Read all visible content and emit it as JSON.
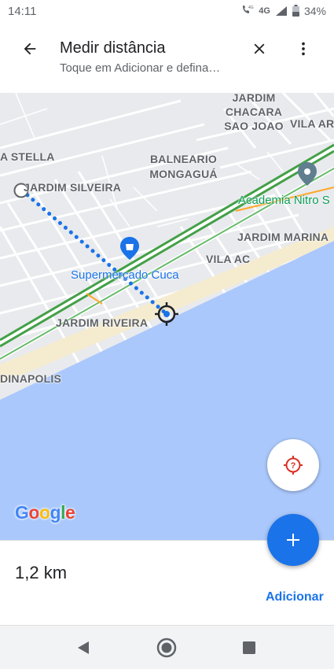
{
  "status_bar": {
    "time": "14:11",
    "network": "4G",
    "battery": "34%"
  },
  "header": {
    "title": "Medir distância",
    "subtitle": "Toque em Adicionar e defina…",
    "icons": {
      "back": "arrow-back-icon",
      "close": "close-icon",
      "more": "more-vert-icon"
    }
  },
  "map": {
    "labels": {
      "jardim_chacara": "JARDIM CHACARA SAO JOAO",
      "vila_ar": "VILA AR",
      "stella": "A STELLA",
      "balneario": "BALNEARIO MONGAGUÁ",
      "jardim_silveira": "JARDIM SILVEIRA",
      "jardim_marina": "JARDIM MARINA",
      "vila_ac": "VILA AC",
      "jardim_riveira": "JARDIM RIVEIRA",
      "dinapolis": "DINAPOLIS"
    },
    "pois": {
      "academia": "Academia Nitro S",
      "supermercado": "Supermercado Cuca"
    },
    "logo": {
      "g1": "G",
      "o1": "o",
      "o2": "o",
      "g2": "g",
      "l": "l",
      "e": "e"
    },
    "colors": {
      "water": "#aac8fc",
      "land": "#e8eaed",
      "road": "#ffffff",
      "highway": "#4caf50",
      "measure_line": "#1a73e8",
      "beach": "#f5ecd0"
    }
  },
  "measure": {
    "distance": "1,2 km",
    "add_label": "Adicionar"
  },
  "nav_bar": {
    "icons": {
      "back": "triangle-back-icon",
      "home": "circle-home-icon",
      "recents": "square-recents-icon"
    }
  }
}
